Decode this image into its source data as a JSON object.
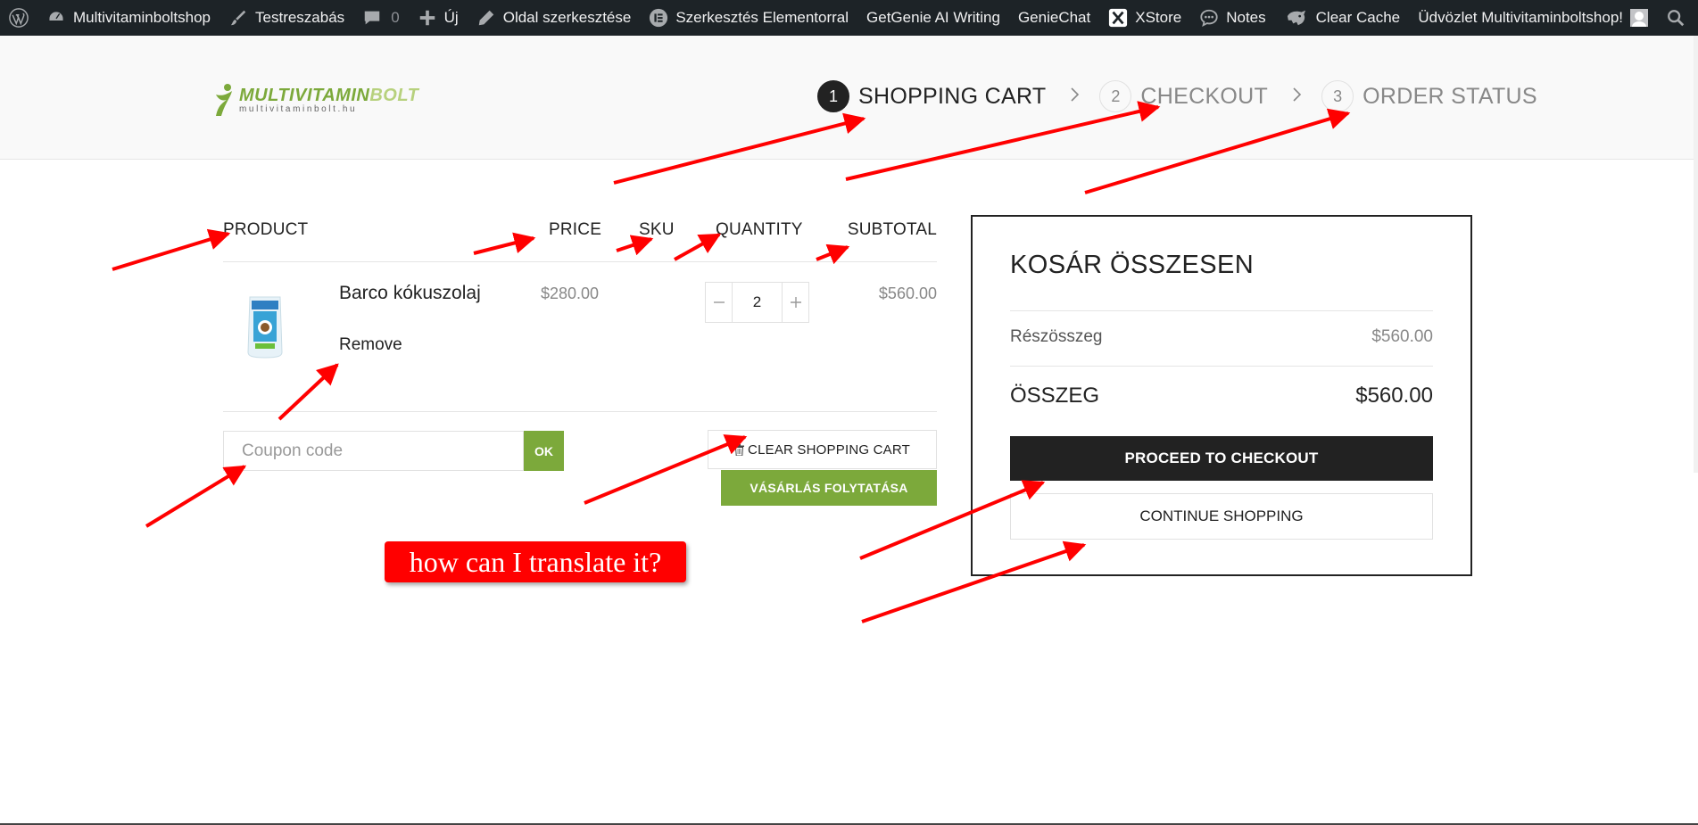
{
  "admin_bar": {
    "site_name": "Multivitaminboltshop",
    "customize": "Testreszabás",
    "comments_count": "0",
    "new": "Új",
    "edit_page": "Oldal szerkesztése",
    "elementor": "Szerkesztés Elementorral",
    "getgenie": "GetGenie AI Writing",
    "geniechat": "GenieChat",
    "xstore": "XStore",
    "notes": "Notes",
    "clear_cache": "Clear Cache",
    "greeting": "Üdvözlet Multivitaminboltshop!"
  },
  "logo": {
    "brand_main": "MULTIVITAMIN",
    "brand_accent": "BOLT",
    "domain": "multivitaminbolt.hu"
  },
  "steps": [
    {
      "num": "1",
      "label": "SHOPPING CART",
      "active": true
    },
    {
      "num": "2",
      "label": "CHECKOUT",
      "active": false
    },
    {
      "num": "3",
      "label": "ORDER STATUS",
      "active": false
    }
  ],
  "cart": {
    "headers": {
      "product": "PRODUCT",
      "price": "PRICE",
      "sku": "SKU",
      "quantity": "QUANTITY",
      "subtotal": "SUBTOTAL"
    },
    "items": [
      {
        "name": "Barco kókuszolaj",
        "remove_label": "Remove",
        "price": "$280.00",
        "quantity": "2",
        "subtotal": "$560.00"
      }
    ],
    "coupon_placeholder": "Coupon code",
    "coupon_button": "OK",
    "clear_button": "CLEAR SHOPPING CART",
    "continue_button": "VÁSÁRLÁS FOLYTATÁSA"
  },
  "totals": {
    "title": "KOSÁR ÖSSZESEN",
    "subtotal_label": "Részösszeg",
    "subtotal_value": "$560.00",
    "total_label": "ÖSSZEG",
    "total_value": "$560.00",
    "checkout_button": "PROCEED TO CHECKOUT",
    "continue_button": "CONTINUE SHOPPING"
  },
  "annotation": {
    "text": "how can I translate it?",
    "color": "#ff0000"
  },
  "colors": {
    "admin_bar": "#1d2327",
    "brand_green": "#7ca93b",
    "dark": "#222222"
  }
}
